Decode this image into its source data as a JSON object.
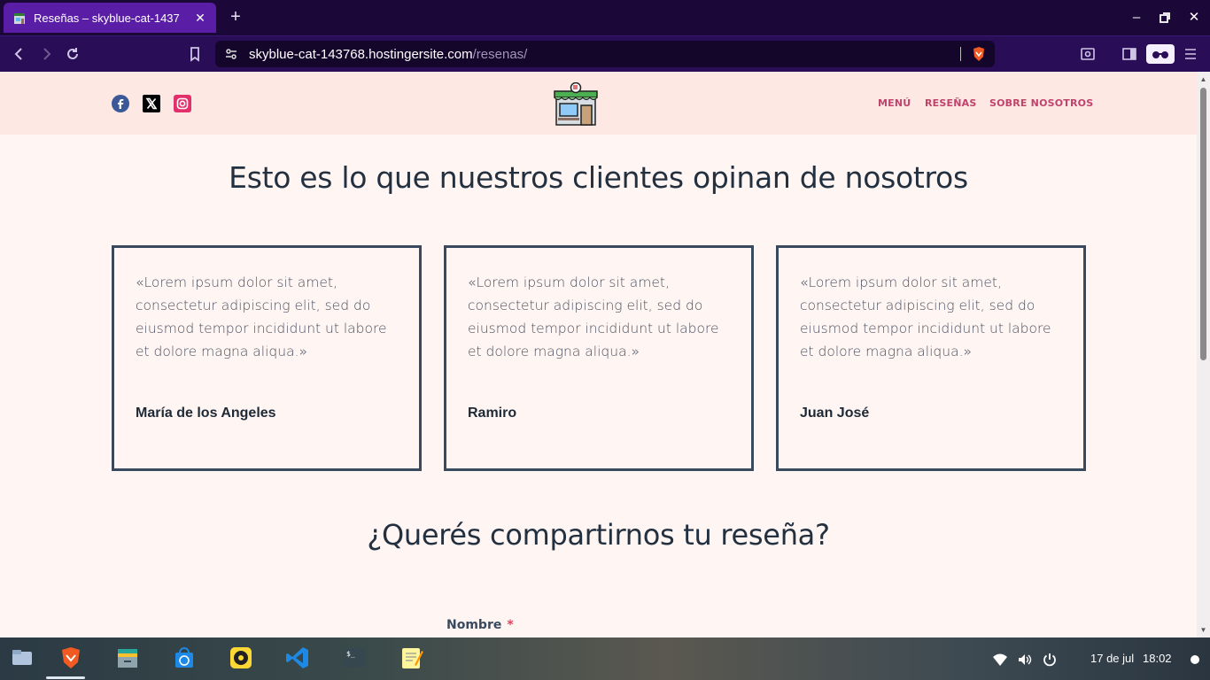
{
  "browser": {
    "tab_title": "Reseñas – skyblue-cat-1437",
    "url_host": "skyblue-cat-143768.hostingersite.com",
    "url_path": "/resenas/",
    "accent": "#5a1ea6"
  },
  "site": {
    "nav": {
      "menu": "MENÚ",
      "reviews": "RESEÑAS",
      "about": "SOBRE NOSOTROS"
    },
    "headline": "Esto es lo que nuestros clientes opinan de nosotros",
    "testimonials": [
      {
        "quote": "«Lorem ipsum dolor sit amet, consectetur adipiscing elit, sed do eiusmod tempor incididunt ut labore et dolore magna aliqua.»",
        "author": "María de los Angeles"
      },
      {
        "quote": "«Lorem ipsum dolor sit amet, consectetur adipiscing elit, sed do eiusmod tempor incididunt ut labore et dolore magna aliqua.»",
        "author": "Ramiro"
      },
      {
        "quote": "«Lorem ipsum dolor sit amet, consectetur adipiscing elit, sed do eiusmod tempor incididunt ut labore et dolore magna aliqua.»",
        "author": "Juan José"
      }
    ],
    "form_heading": "¿Querés compartirnos tu reseña?",
    "form": {
      "name_label": "Nombre",
      "required_mark": "*"
    },
    "colors": {
      "nav_link": "#c0436b",
      "card_border": "#3a4a5e",
      "header_bg": "#fde8e3"
    }
  },
  "taskbar": {
    "date": "17 de jul",
    "time": "18:02",
    "apps": [
      "files-icon",
      "brave-icon",
      "archive-icon",
      "store-icon",
      "music-icon",
      "vscode-icon",
      "terminal-icon",
      "notes-icon"
    ]
  }
}
